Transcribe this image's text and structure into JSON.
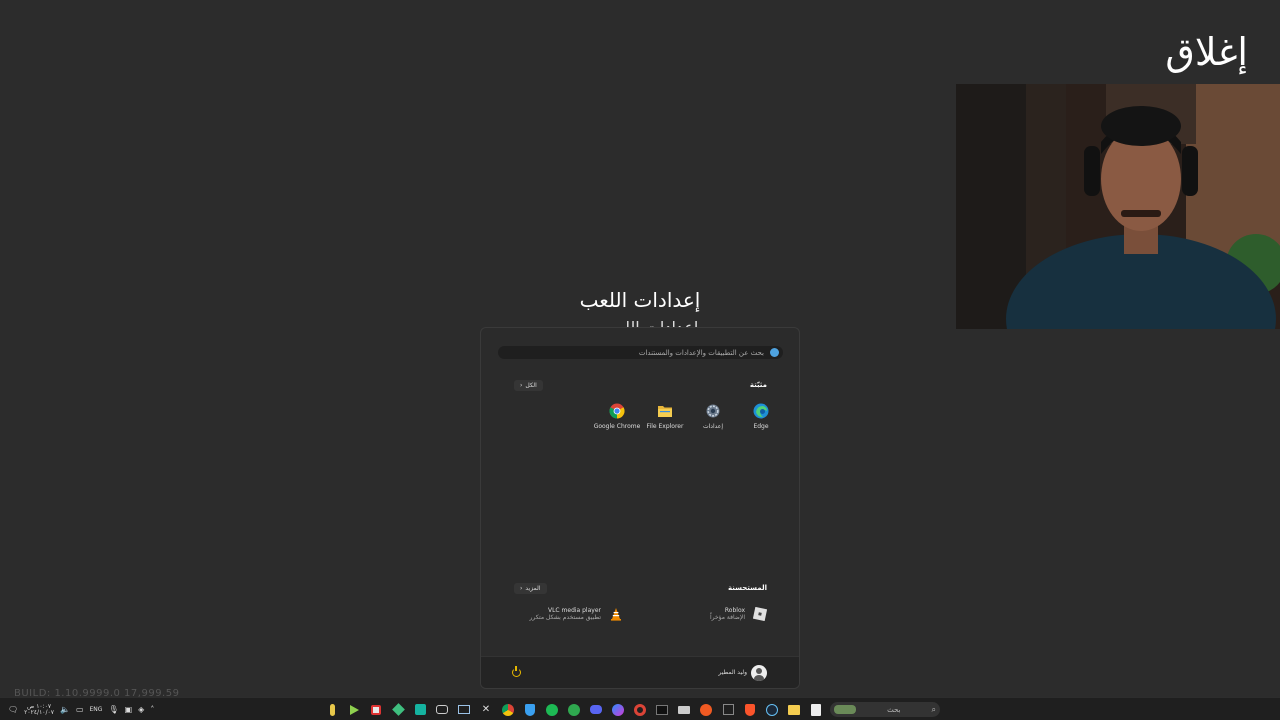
{
  "overlay": {
    "close_label": "إغلاق",
    "game_settings_title": "إعدادات اللعب",
    "build_text": "BUILD: 1.10.9999.0 17,999.59"
  },
  "start_menu": {
    "search_placeholder": "بحث عن التطبيقات والإعدادات والمستندات",
    "pinned_title": "مثبّتة",
    "all_button": "الكل",
    "pinned_apps": [
      {
        "label": "Edge",
        "icon": "edge-icon"
      },
      {
        "label": "إعدادات",
        "icon": "settings-gear-icon"
      },
      {
        "label": "File Explorer",
        "icon": "folder-icon"
      },
      {
        "label": "Google Chrome",
        "icon": "chrome-icon"
      }
    ],
    "recommended_title": "المستحسنة",
    "more_button": "المزيد",
    "recommended": [
      {
        "name": "Roblox",
        "sub": "الإضافة مؤخراً",
        "icon": "roblox-icon"
      },
      {
        "name": "VLC media player",
        "sub": "تطبيق مستخدم بشكل متكرر",
        "icon": "vlc-cone-icon"
      }
    ],
    "user_name": "وليد المطير"
  },
  "taskbar": {
    "time": "١٠:٠٧ ص",
    "date": "٢٠٢٤/١٠/٠٧",
    "language": "ENG",
    "search_label": "بحث",
    "colors": {
      "accent": "#3aa0f0",
      "background": "#1f1f1f"
    }
  }
}
